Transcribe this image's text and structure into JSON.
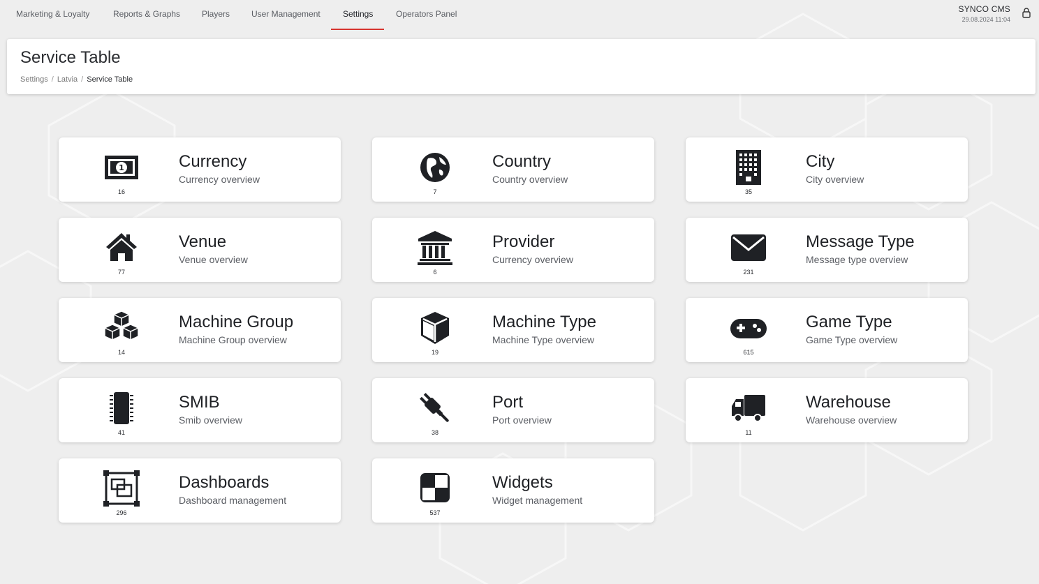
{
  "nav": {
    "items": [
      {
        "label": "Marketing & Loyalty"
      },
      {
        "label": "Reports & Graphs"
      },
      {
        "label": "Players"
      },
      {
        "label": "User Management"
      },
      {
        "label": "Settings",
        "active": true
      },
      {
        "label": "Operators Panel"
      }
    ],
    "brand": "SYNCO CMS",
    "datetime": "29.08.2024 11:04",
    "user_icon": "user-lock-icon"
  },
  "header": {
    "title": "Service Table",
    "breadcrumb": [
      "Settings",
      "Latvia",
      "Service Table"
    ]
  },
  "colors": {
    "accent": "#d6342e",
    "icon": "#1f2125",
    "card": "#ffffff",
    "background": "#eeeeee"
  },
  "tiles": [
    {
      "title": "Currency",
      "subtitle": "Currency overview",
      "count": "16",
      "icon": "banknote-icon"
    },
    {
      "title": "Country",
      "subtitle": "Country overview",
      "count": "7",
      "icon": "globe-icon"
    },
    {
      "title": "City",
      "subtitle": "City overview",
      "count": "35",
      "icon": "building-icon"
    },
    {
      "title": "Venue",
      "subtitle": "Venue overview",
      "count": "77",
      "icon": "home-icon"
    },
    {
      "title": "Provider",
      "subtitle": "Currency overview",
      "count": "6",
      "icon": "bank-icon"
    },
    {
      "title": "Message Type",
      "subtitle": "Message type overview",
      "count": "231",
      "icon": "envelope-icon"
    },
    {
      "title": "Machine Group",
      "subtitle": "Machine Group overview",
      "count": "14",
      "icon": "cubes-icon"
    },
    {
      "title": "Machine Type",
      "subtitle": "Machine Type overview",
      "count": "19",
      "icon": "cube-icon"
    },
    {
      "title": "Game Type",
      "subtitle": "Game Type overview",
      "count": "615",
      "icon": "gamepad-icon"
    },
    {
      "title": "SMIB",
      "subtitle": "Smib overview",
      "count": "41",
      "icon": "chip-icon"
    },
    {
      "title": "Port",
      "subtitle": "Port overview",
      "count": "38",
      "icon": "plug-icon"
    },
    {
      "title": "Warehouse",
      "subtitle": "Warehouse overview",
      "count": "11",
      "icon": "truck-icon"
    },
    {
      "title": "Dashboards",
      "subtitle": "Dashboard management",
      "count": "296",
      "icon": "dashboard-frame-icon"
    },
    {
      "title": "Widgets",
      "subtitle": "Widget management",
      "count": "537",
      "icon": "widget-icon"
    }
  ]
}
